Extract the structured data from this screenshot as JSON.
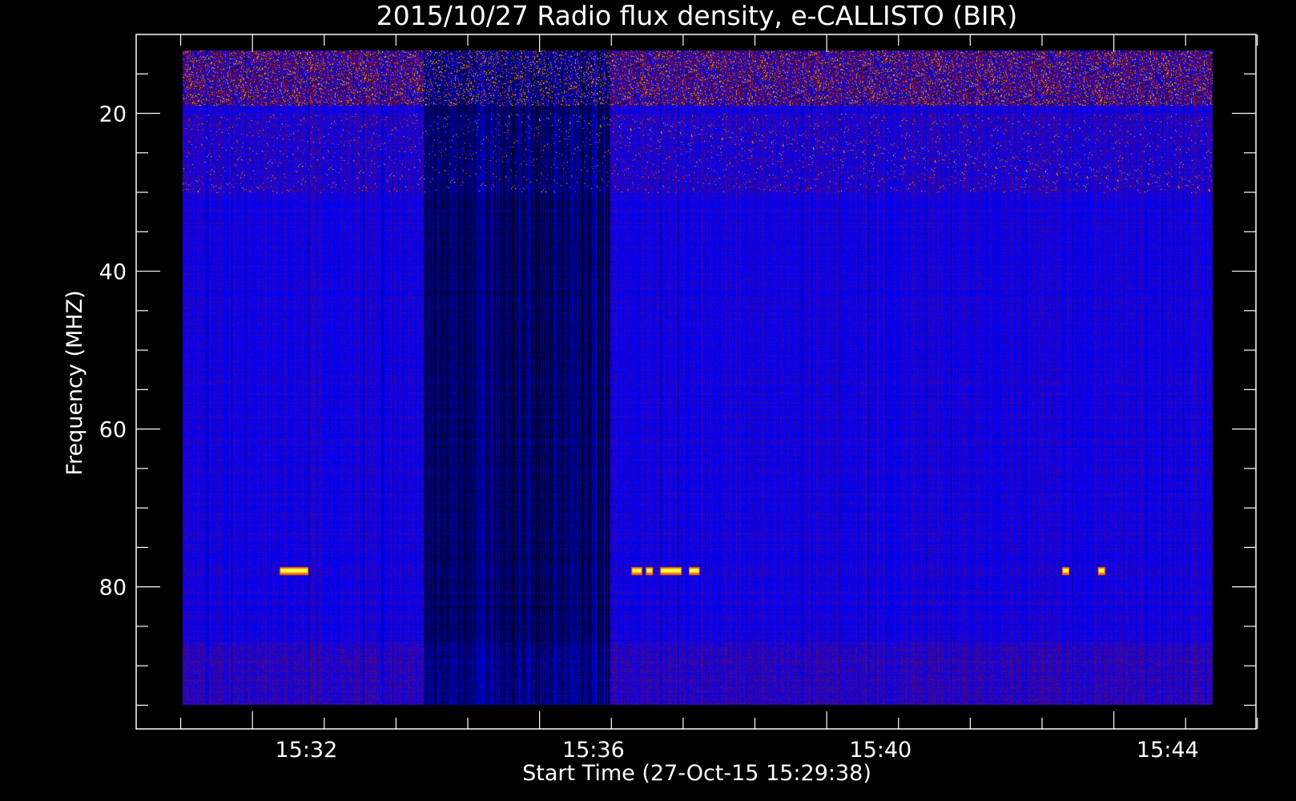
{
  "chart_data": {
    "type": "heatmap",
    "title": "2015/10/27  Radio flux density, e-CALLISTO (BIR)",
    "xlabel": "Start Time (27-Oct-15 15:29:38)",
    "ylabel": "Frequency (MHZ)",
    "x_tick_labels": [
      "15:32",
      "15:36",
      "15:40",
      "15:44"
    ],
    "x_tick_minutes": [
      2.37,
      6.37,
      10.37,
      14.37
    ],
    "x_range_minutes": [
      0,
      15.6
    ],
    "y_tick_labels": [
      "20",
      "40",
      "60",
      "80"
    ],
    "y_tick_values": [
      20,
      40,
      60,
      80
    ],
    "y_range": [
      10,
      98
    ],
    "data_extent": {
      "freq_min": 12,
      "freq_max": 95,
      "time_min": 0.65,
      "time_max": 15.0
    },
    "y_inverted": true,
    "colormap": [
      "#000000",
      "#0000ff",
      "#8b1010",
      "#ff4500",
      "#ffff00"
    ],
    "features": {
      "rfi_band_top": [
        12,
        19
      ],
      "rfi_band_mid": [
        20,
        30
      ],
      "rfi_band_bottom": [
        87,
        95
      ],
      "dark_interval_minutes": [
        4.0,
        6.6
      ],
      "bright_blips": [
        {
          "t": 2.0,
          "t2": 2.4,
          "f": 78
        },
        {
          "t": 6.9,
          "t2": 7.05,
          "f": 78
        },
        {
          "t": 7.1,
          "t2": 7.2,
          "f": 78
        },
        {
          "t": 7.3,
          "t2": 7.6,
          "f": 78
        },
        {
          "t": 7.7,
          "t2": 7.85,
          "f": 78
        },
        {
          "t": 12.9,
          "t2": 13.0,
          "f": 78
        },
        {
          "t": 13.4,
          "t2": 13.5,
          "f": 78
        }
      ]
    }
  }
}
